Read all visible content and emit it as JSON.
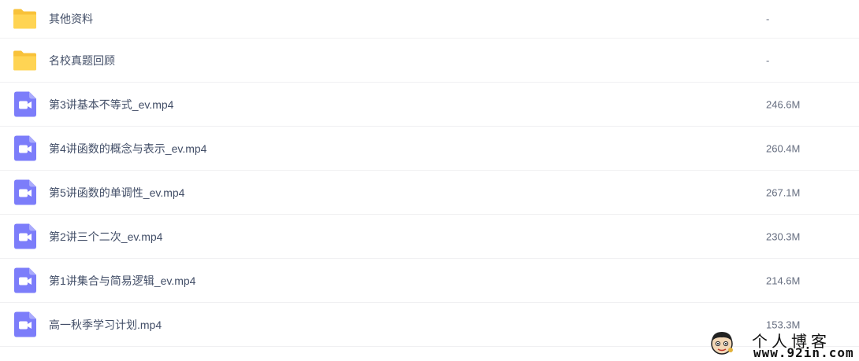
{
  "files": [
    {
      "icon": "folder-icon",
      "name": "其他资料",
      "size": "-"
    },
    {
      "icon": "folder-icon",
      "name": "名校真题回顾",
      "size": "-"
    },
    {
      "icon": "video-file-icon",
      "name": "第3讲基本不等式_ev.mp4",
      "size": "246.6M"
    },
    {
      "icon": "video-file-icon",
      "name": "第4讲函数的概念与表示_ev.mp4",
      "size": "260.4M"
    },
    {
      "icon": "video-file-icon",
      "name": "第5讲函数的单调性_ev.mp4",
      "size": "267.1M"
    },
    {
      "icon": "video-file-icon",
      "name": "第2讲三个二次_ev.mp4",
      "size": "230.3M"
    },
    {
      "icon": "video-file-icon",
      "name": "第1讲集合与简易逻辑_ev.mp4",
      "size": "214.6M"
    },
    {
      "icon": "video-file-icon",
      "name": "高一秋季学习计划.mp4",
      "size": "153.3M"
    }
  ],
  "watermark": {
    "title": "个人博客",
    "url": "www.92in.com"
  },
  "colors": {
    "folder": "#ffd04b",
    "video": "#7c7dfa",
    "text": "#424e67",
    "divider": "#f0f0f2"
  }
}
